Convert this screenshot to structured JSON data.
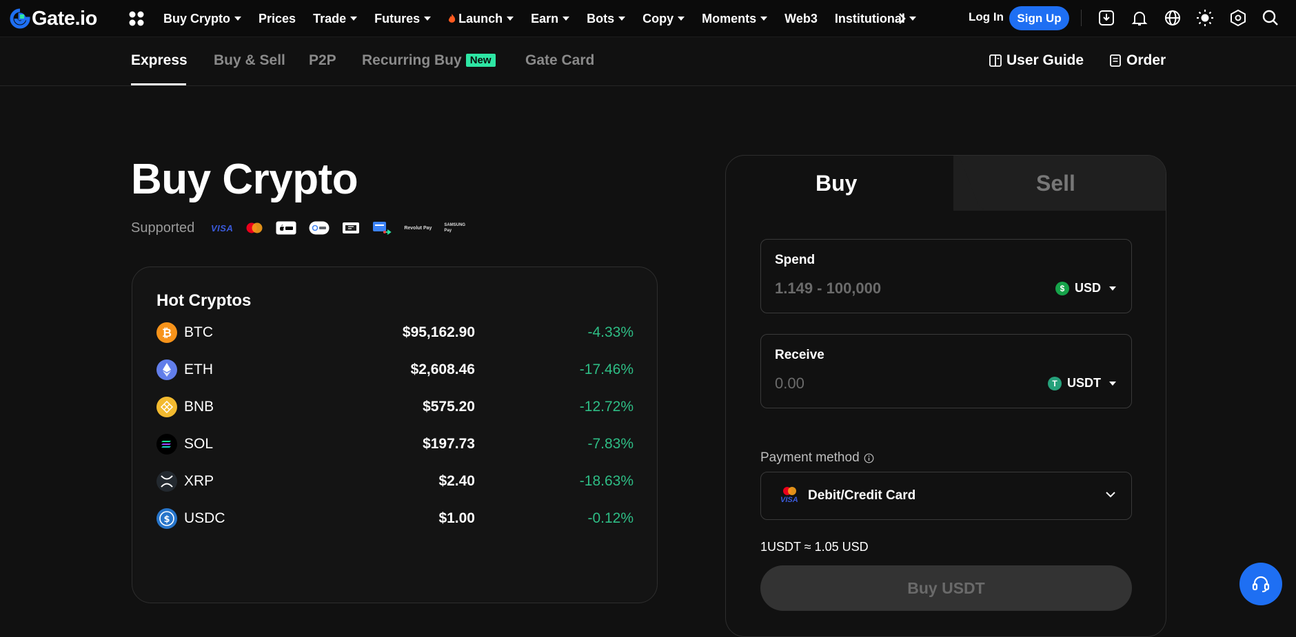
{
  "brand": {
    "name": "Gate.io",
    "accent": "#1e6ff3",
    "positive": "#2ebd85",
    "new_badge": "#2ee6a4"
  },
  "topnav": {
    "items": [
      {
        "label": "Buy Crypto",
        "dropdown": true
      },
      {
        "label": "Prices",
        "dropdown": false
      },
      {
        "label": "Trade",
        "dropdown": true
      },
      {
        "label": "Futures",
        "dropdown": true
      },
      {
        "label": "Launch",
        "dropdown": true,
        "icon": "flame-icon"
      },
      {
        "label": "Earn",
        "dropdown": true
      },
      {
        "label": "Bots",
        "dropdown": true
      },
      {
        "label": "Copy",
        "dropdown": true
      },
      {
        "label": "Moments",
        "dropdown": true
      },
      {
        "label": "Web3",
        "dropdown": false
      },
      {
        "label": "Institutional",
        "dropdown": true
      }
    ],
    "login": "Log In",
    "signup": "Sign Up",
    "icons": [
      "download-icon",
      "bell-icon",
      "globe-icon",
      "theme-sun-icon",
      "settings-hex-icon",
      "search-icon"
    ]
  },
  "subnav": {
    "tabs": [
      {
        "label": "Express",
        "active": true
      },
      {
        "label": "Buy & Sell",
        "active": false
      },
      {
        "label": "P2P",
        "active": false
      },
      {
        "label": "Recurring Buy",
        "active": false,
        "badge": "New"
      },
      {
        "label": "Gate Card",
        "active": false
      }
    ],
    "user_guide": "User Guide",
    "order": "Order"
  },
  "hero": {
    "title": "Buy Crypto",
    "supported_label": "Supported",
    "payment_icons": [
      "visa-icon",
      "mastercard-icon",
      "apple-pay-icon",
      "google-pay-icon",
      "bank-transfer-icon",
      "card-transfer-icon",
      "revolut-pay-icon",
      "samsung-pay-icon"
    ]
  },
  "hot_cryptos": {
    "title": "Hot Cryptos",
    "rows": [
      {
        "symbol": "BTC",
        "price": "$95,162.90",
        "change": "-4.33%",
        "color": "#f7931a"
      },
      {
        "symbol": "ETH",
        "price": "$2,608.46",
        "change": "-17.46%",
        "color": "#627eea"
      },
      {
        "symbol": "BNB",
        "price": "$575.20",
        "change": "-12.72%",
        "color": "#f3ba2f"
      },
      {
        "symbol": "SOL",
        "price": "$197.73",
        "change": "-7.83%",
        "color": "#000000"
      },
      {
        "symbol": "XRP",
        "price": "$2.40",
        "change": "-18.63%",
        "color": "#23292f"
      },
      {
        "symbol": "USDC",
        "price": "$1.00",
        "change": "-0.12%",
        "color": "#2775ca"
      }
    ]
  },
  "trade": {
    "tabs": {
      "buy": "Buy",
      "sell": "Sell"
    },
    "spend": {
      "label": "Spend",
      "placeholder": "1.149 - 100,000",
      "currency": "USD",
      "currency_icon": "$"
    },
    "receive": {
      "label": "Receive",
      "placeholder": "0.00",
      "currency": "USDT",
      "currency_icon": "T"
    },
    "payment_method_label": "Payment method",
    "payment_method_value": "Debit/Credit Card",
    "rate": "1USDT ≈ 1.05 USD",
    "button": "Buy USDT"
  },
  "wordmarks": {
    "visa": "VISA",
    "visa_small": "VISA",
    "revolut": "Revolut Pay",
    "samsung_1": "SAMSUNG",
    "samsung_2": "Pay"
  }
}
